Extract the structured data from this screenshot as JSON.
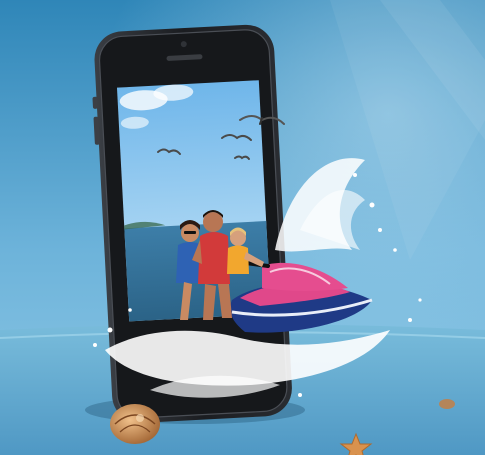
{
  "scene": {
    "description_tags": [
      "phone-mockup",
      "jet-ski",
      "ocean",
      "seagulls",
      "splash",
      "seashell",
      "starfish"
    ]
  },
  "colors": {
    "sky_top": "#2e86b8",
    "sky_bottom": "#8fc9e6",
    "water_surface": "#6fb5d6",
    "phone_body": "#1b1d21",
    "phone_bezel": "#2b2e33",
    "screen_sky": "#8ec8ef",
    "screen_sea": "#3e7ea6",
    "jetski_pink": "#e0488a",
    "jetski_blue": "#1f3a86",
    "splash": "#ffffff",
    "shell": "#c98a52",
    "starfish": "#d9924e"
  }
}
